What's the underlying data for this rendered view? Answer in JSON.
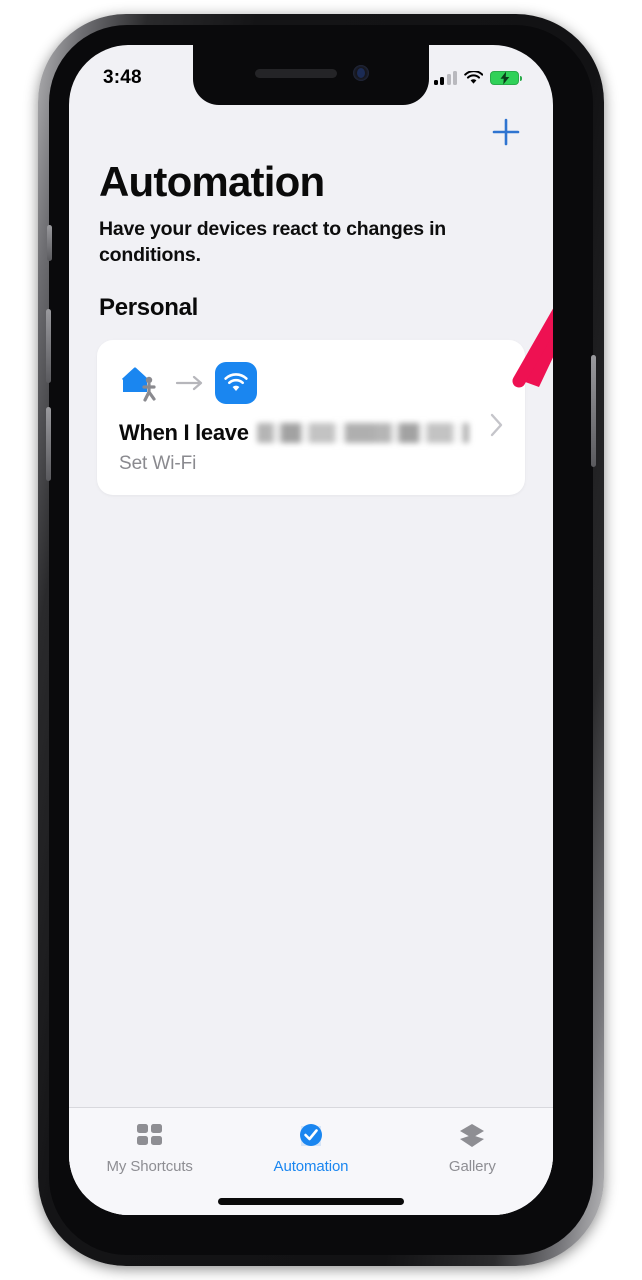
{
  "device": {
    "name": "iphone-frame",
    "notch": "notch",
    "home_indicator": "home-indicator"
  },
  "status_bar": {
    "time": "3:48",
    "cellular_icon": "cellular-signal-icon",
    "wifi_icon": "wifi-icon",
    "battery_icon": "battery-charging-icon",
    "battery_color": "#30d158"
  },
  "nav": {
    "add_icon": "plus-icon",
    "add_label": "+",
    "accent_color": "#2f74d0"
  },
  "header": {
    "title": "Automation",
    "subtitle": "Have your devices react to changes in conditions."
  },
  "sections": [
    {
      "title": "Personal",
      "automations": [
        {
          "trigger_icon": "house-leaving-icon",
          "arrow_icon": "arrow-right-icon",
          "action_icon": "wifi-tile-icon",
          "action_icon_color": "#1a86f0",
          "title_prefix": "When I leave",
          "title_redacted": true,
          "subtitle": "Set Wi-Fi",
          "chevron_icon": "chevron-right-icon"
        }
      ]
    }
  ],
  "tab_bar": {
    "active_color": "#1a86f0",
    "inactive_color": "#8e8e93",
    "tabs": [
      {
        "label": "My Shortcuts",
        "icon": "grid-icon",
        "active": false
      },
      {
        "label": "Automation",
        "icon": "check-circle-icon",
        "active": true
      },
      {
        "label": "Gallery",
        "icon": "layers-icon",
        "active": false
      }
    ]
  },
  "annotation": {
    "type": "arrow",
    "color": "#ee1152",
    "points_to": "plus-icon",
    "direction": "up-right"
  }
}
